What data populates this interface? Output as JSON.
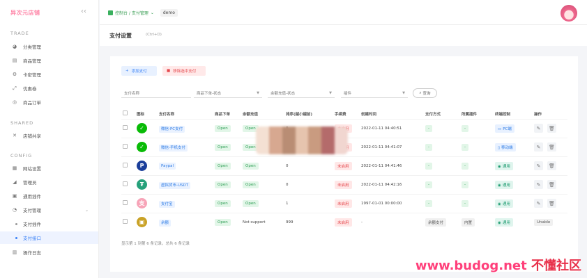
{
  "brand": "异次元店铺",
  "sidebar": {
    "sections": [
      "TRADE",
      "SHARED",
      "CONFIG"
    ],
    "items": [
      {
        "label": "分类管理",
        "icon": "category-icon"
      },
      {
        "label": "商品管理",
        "icon": "goods-icon"
      },
      {
        "label": "卡密管理",
        "icon": "card-icon"
      },
      {
        "label": "优惠卷",
        "icon": "coupon-icon"
      },
      {
        "label": "商品订单",
        "icon": "order-icon"
      },
      {
        "label": "店铺共享",
        "icon": "share-icon"
      },
      {
        "label": "网站设置",
        "icon": "settings-icon"
      },
      {
        "label": "管理员",
        "icon": "admin-icon"
      },
      {
        "label": "通用插件",
        "icon": "plugin-icon"
      },
      {
        "label": "支付管理",
        "icon": "payment-icon"
      },
      {
        "label": "支付插件"
      },
      {
        "label": "支付接口"
      },
      {
        "label": "操作日志",
        "icon": "log-icon"
      }
    ]
  },
  "topbar": {
    "breadcrumb": "控制台 / 支付管理",
    "demo": "demo"
  },
  "page": {
    "title": "支付设置",
    "subtitle": "(Ctrl+D)"
  },
  "toolbar": {
    "add_label": "添加支付",
    "delete_label": "移除选中支付"
  },
  "filters": {
    "name_placeholder": "支付名称",
    "order_status": "商品下单-状态",
    "recharge_status": "余额充值-状态",
    "plugin": "插件",
    "search_label": "查询"
  },
  "table": {
    "headers": [
      "",
      "图标",
      "支付名称",
      "商品下单",
      "余额充值",
      "排序(越小越前)",
      "手续费",
      "创建时间",
      "支付方式",
      "所属插件",
      "终端控制",
      "操作"
    ],
    "rows": [
      {
        "icon": "wechat-icon",
        "icon_color": "#09bb07",
        "glyph": "✓",
        "name": "微信-PC支付",
        "order": "Open",
        "recharge": "Open",
        "sort": "0",
        "fee": "未启用",
        "created": "2022-01-11 04:40:51",
        "method": "-",
        "plugin": "-",
        "terminal": "PC端",
        "terminal_icon": "desktop-icon",
        "terminal_style": "blue"
      },
      {
        "icon": "wechat-icon",
        "icon_color": "#09bb07",
        "glyph": "✓",
        "name": "微信-手机支付",
        "order": "Open",
        "recharge": "Open",
        "sort": "",
        "fee": "未启用",
        "created": "2022-01-11 04:41:07",
        "method": "-",
        "plugin": "-",
        "terminal": "移动端",
        "terminal_icon": "mobile-icon",
        "terminal_style": "blue"
      },
      {
        "icon": "paypal-icon",
        "icon_color": "#1a3e9a",
        "glyph": "P",
        "name": "Paypal",
        "order": "Open",
        "recharge": "Open",
        "sort": "0",
        "fee": "未启用",
        "created": "2022-01-11 04:41:46",
        "method": "-",
        "plugin": "-",
        "terminal": "通用",
        "terminal_icon": "globe-icon",
        "terminal_style": "teal"
      },
      {
        "icon": "usdt-icon",
        "icon_color": "#26a17b",
        "glyph": "₮",
        "name": "虚拟货币-USDT",
        "order": "Open",
        "recharge": "Open",
        "sort": "0",
        "fee": "未启用",
        "created": "2022-01-11 04:42:16",
        "method": "-",
        "plugin": "-",
        "terminal": "通用",
        "terminal_icon": "globe-icon",
        "terminal_style": "teal"
      },
      {
        "icon": "alipay-icon",
        "icon_color": "#f7a4b8",
        "glyph": "支",
        "name": "支付宝",
        "order": "Open",
        "recharge": "Open",
        "sort": "1",
        "fee": "未启用",
        "created": "1997-01-01 00:00:00",
        "method": "-",
        "plugin": "-",
        "terminal": "通用",
        "terminal_icon": "globe-icon",
        "terminal_style": "teal"
      },
      {
        "icon": "wallet-icon",
        "icon_color": "#c9a227",
        "glyph": "▣",
        "name": "余额",
        "order": "Open",
        "recharge": "Not support",
        "sort": "999",
        "fee": "未启用",
        "created": "-",
        "method": "余额支付",
        "plugin": "内置",
        "terminal": "通用",
        "terminal_icon": "globe-icon",
        "terminal_style": "teal",
        "action": "Unable"
      }
    ]
  },
  "footer": "显示第 1 到第 6 条记录，总共 6 条记录",
  "watermark": {
    "url": "www.budog.net",
    "cn": "不懂社区"
  },
  "colors": {
    "accent": "#3b82f6",
    "brand": "#ff86a8",
    "open": "#2f9e55",
    "disabled": "#e5484d"
  }
}
